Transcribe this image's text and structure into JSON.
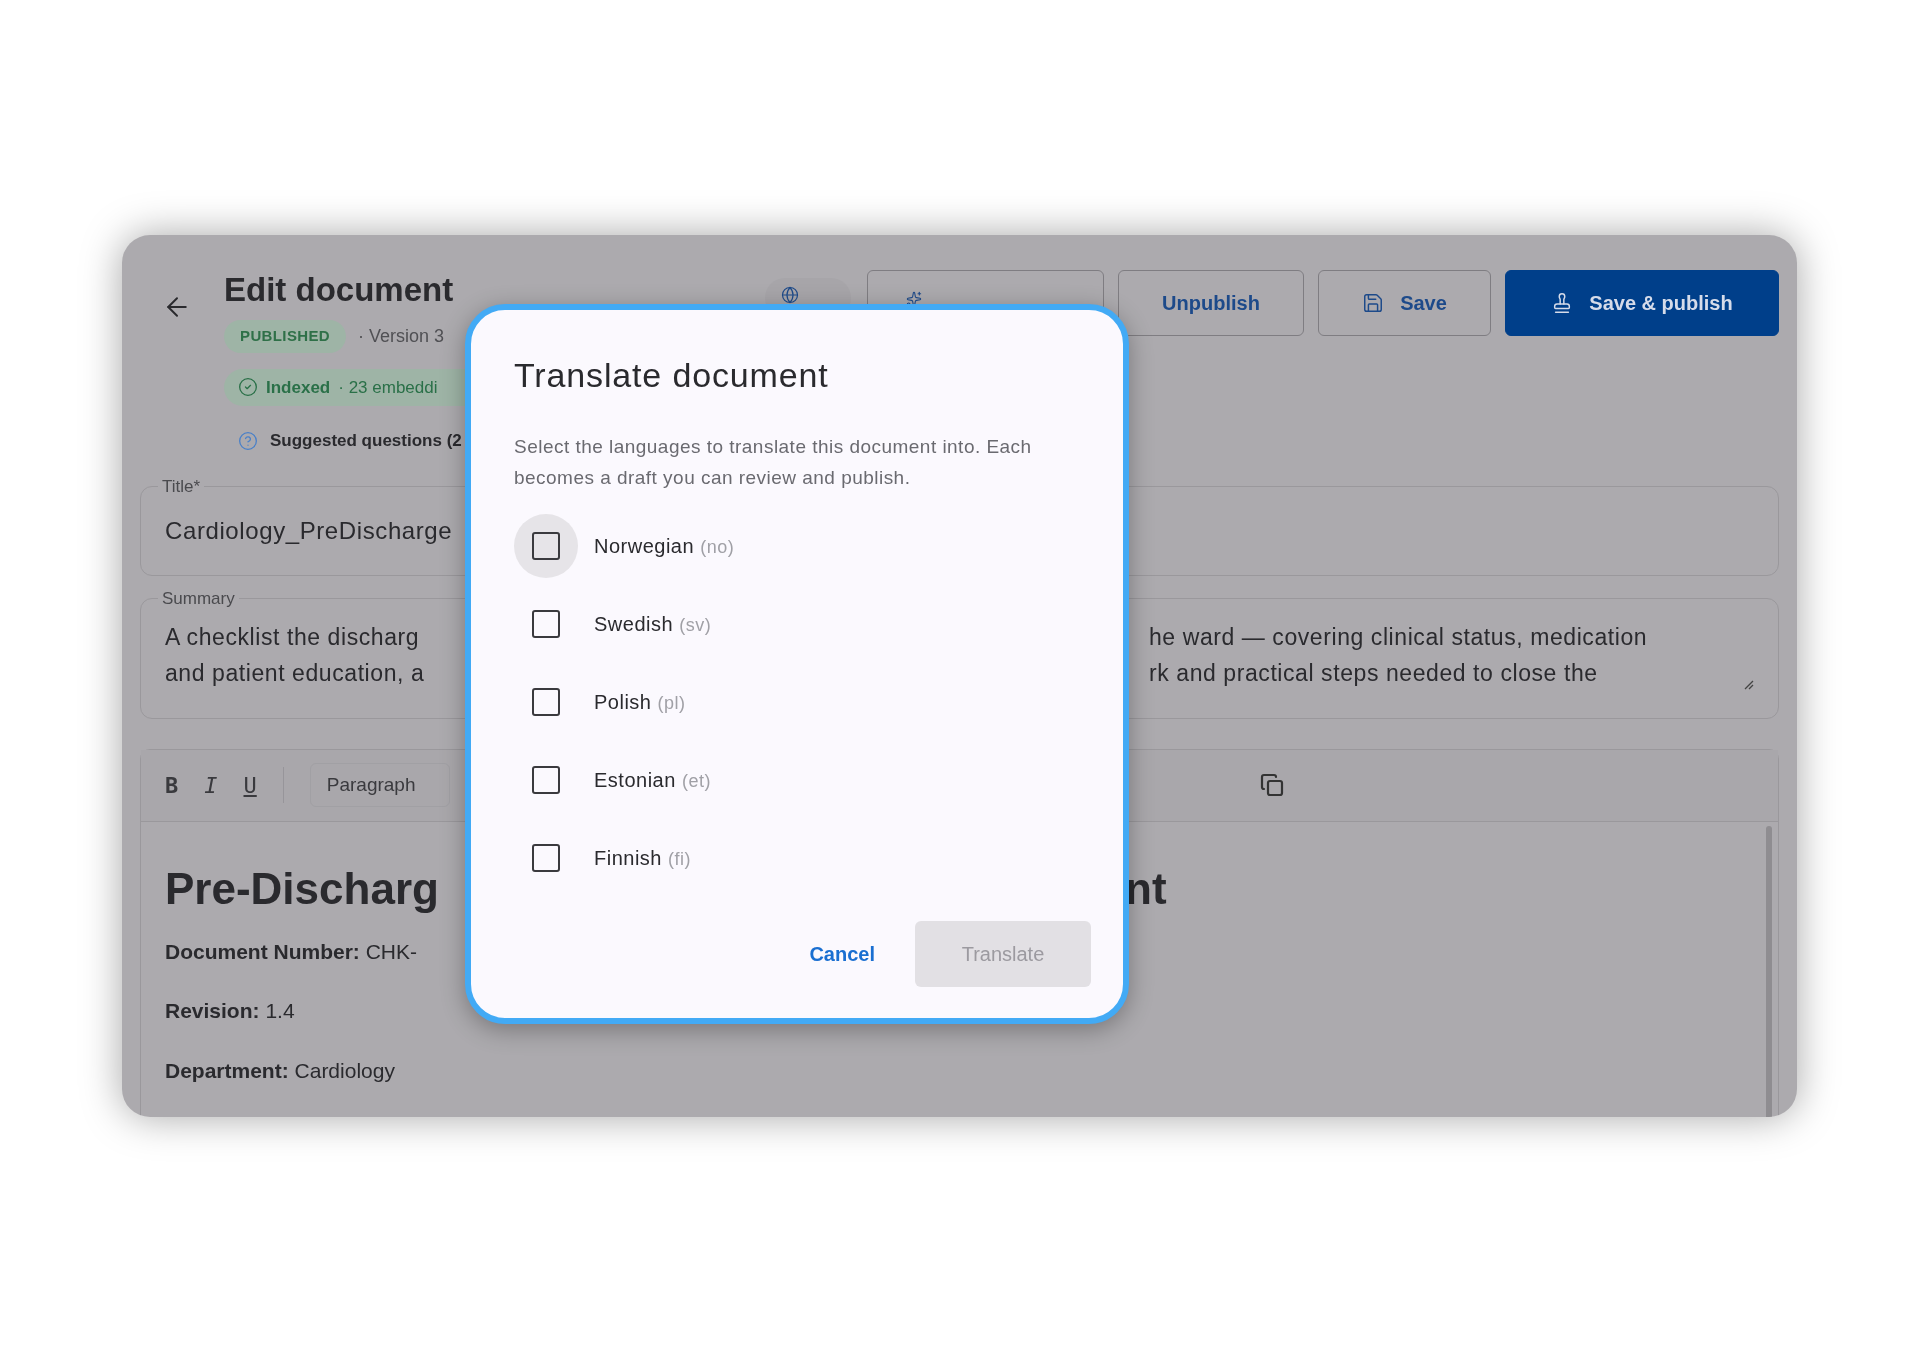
{
  "header": {
    "title": "Edit document",
    "status_badge": "PUBLISHED",
    "version": "· Version 3",
    "index_badge": {
      "label": "Indexed",
      "detail": "· 23 embeddi"
    },
    "suggested": "Suggested questions (2",
    "buttons": [
      {
        "label": "Unpublish",
        "kind": "outline"
      },
      {
        "label": "Save",
        "kind": "outline"
      },
      {
        "label": "Save & publish",
        "kind": "primary"
      }
    ]
  },
  "title_field": {
    "label": "Title*",
    "value": "Cardiology_PreDischarge"
  },
  "summary_field": {
    "label": "Summary",
    "left_lines": [
      "A checklist the discharg",
      "and patient education, a"
    ],
    "right_lines": [
      "he ward — covering clinical status, medication",
      "rk and practical steps needed to close the"
    ]
  },
  "toolbar": {
    "format_buttons": [
      "B",
      "I",
      "U"
    ],
    "block_style": "Paragraph"
  },
  "content": {
    "heading_left": "Pre-Discharg",
    "heading_right": "nt",
    "fields": [
      {
        "label": "Document Number:",
        "value": "CHK-"
      },
      {
        "label": "Revision:",
        "value": "1.4"
      },
      {
        "label": "Department:",
        "value": "Cardiology"
      }
    ]
  },
  "dialog": {
    "title": "Translate document",
    "description": "Select the languages to translate this document into. Each becomes a draft you can review and publish.",
    "languages": [
      {
        "name": "Norwegian",
        "code": "(no)",
        "checked": false,
        "focused": true
      },
      {
        "name": "Swedish",
        "code": "(sv)",
        "checked": false,
        "focused": false
      },
      {
        "name": "Polish",
        "code": "(pl)",
        "checked": false,
        "focused": false
      },
      {
        "name": "Estonian",
        "code": "(et)",
        "checked": false,
        "focused": false
      },
      {
        "name": "Finnish",
        "code": "(fi)",
        "checked": false,
        "focused": false
      }
    ],
    "cancel": "Cancel",
    "confirm": {
      "label": "Translate",
      "disabled": true
    }
  }
}
